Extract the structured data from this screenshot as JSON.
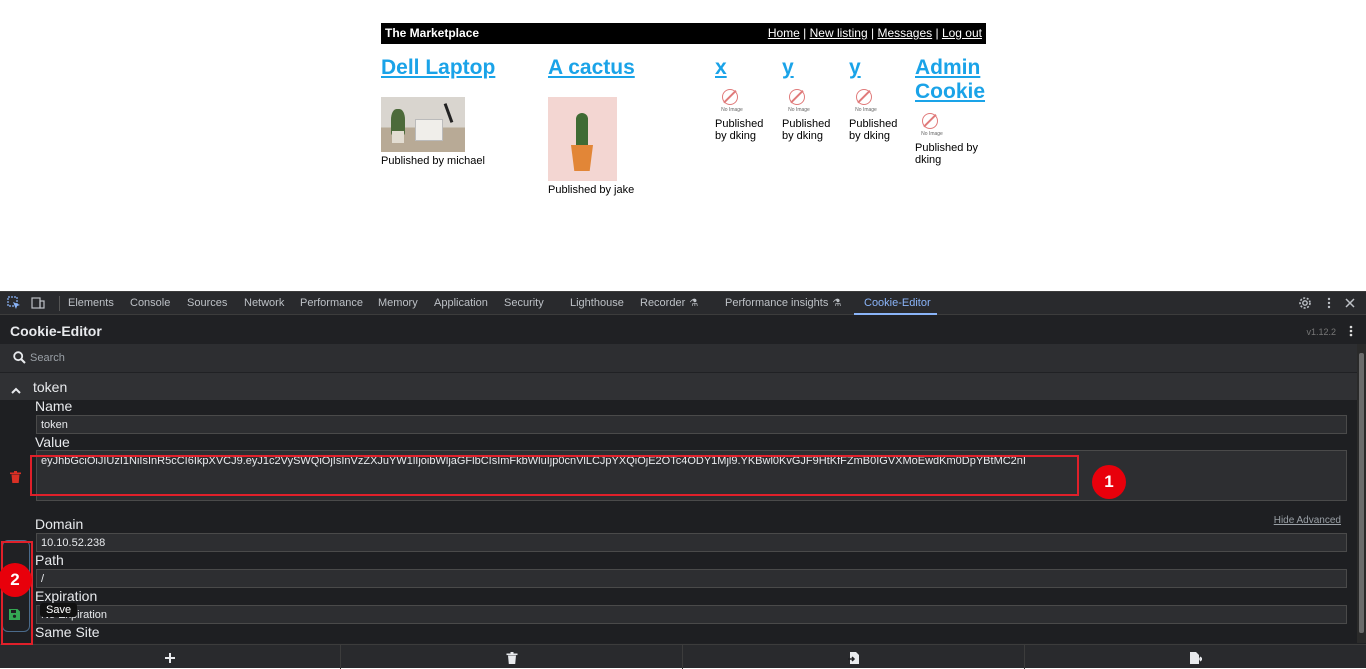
{
  "site": {
    "brand": "The Marketplace",
    "nav": {
      "home": "Home",
      "new_listing": "New listing",
      "messages": "Messages",
      "logout": "Log out",
      "sep": " | "
    },
    "listings": [
      {
        "title": "Dell Laptop",
        "published": "Published by michael"
      },
      {
        "title": "A cactus",
        "published": "Published by jake"
      },
      {
        "title": "x",
        "published": "Published by dking",
        "noimage": "No Image"
      },
      {
        "title": "y",
        "published": "Published by dking",
        "noimage": "No Image"
      },
      {
        "title": "y",
        "published": "Published by dking",
        "noimage": "No Image"
      },
      {
        "title": "Admin Cookie",
        "published": "Published by dking",
        "noimage": "No Image"
      }
    ]
  },
  "devtools": {
    "tabs": [
      "Elements",
      "Console",
      "Sources",
      "Network",
      "Performance",
      "Memory",
      "Application",
      "Security",
      "Lighthouse",
      "Recorder",
      "Performance insights",
      "Cookie-Editor"
    ],
    "active_tab": "Cookie-Editor",
    "icons": [
      "inspect-icon",
      "device-toolbar-icon",
      "settings-icon",
      "more-vert-icon",
      "close-icon"
    ]
  },
  "cookie_editor": {
    "title": "Cookie-Editor",
    "version": "v1.12.2",
    "search_placeholder": "Search",
    "cookie_name_header": "token",
    "labels": {
      "name": "Name",
      "value": "Value",
      "domain": "Domain",
      "path": "Path",
      "expiration": "Expiration",
      "same_site": "Same Site"
    },
    "fields": {
      "name": "token",
      "value": "eyJhbGciOiJIUzI1NiIsInR5cCI6IkpXVCJ9.eyJ1c2VySWQiOjIsInVzZXJuYW1lIjoibWljaGFlbCIsImFkbWluIjp0cnVlLCJpYXQiOjE2OTc4ODY1Mjl9.YKBwl0KvGJF9HtKfFZmB0IGVXMoEwdKm0DpYBtMC2nI",
      "domain": "10.10.52.238",
      "path": "/",
      "expiration": "No Expiration"
    },
    "hide_advanced": "Hide Advanced",
    "save_tooltip": "Save",
    "bottom_actions": [
      "add-icon",
      "delete-all-icon",
      "import-icon",
      "export-icon"
    ]
  },
  "annotations": [
    "1",
    "2"
  ],
  "colors": {
    "accent": "#8ab4f8",
    "link": "#1aa3e8",
    "annotation_red": "#e0202a",
    "delete_red": "#d93025",
    "save_green": "#34a853"
  }
}
